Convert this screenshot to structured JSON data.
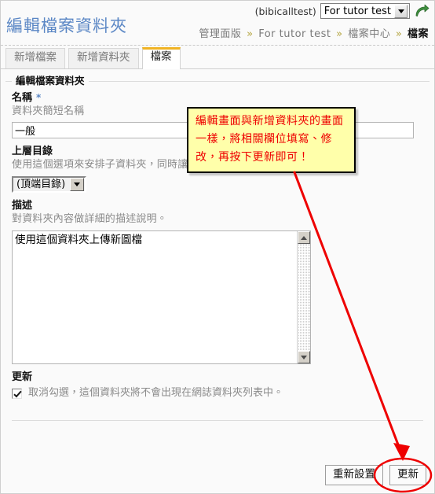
{
  "header": {
    "title": "編輯檔案資料夾",
    "user_label": "(bibicalltest)",
    "site_select_value": "For tutor test",
    "go_icon": "curved-arrow-icon",
    "breadcrumb": [
      {
        "label": "管理面版",
        "last": false
      },
      {
        "label": "For tutor test",
        "last": false
      },
      {
        "label": "檔案中心",
        "last": false
      },
      {
        "label": "檔案",
        "last": true
      }
    ],
    "breadcrumb_separator": "»"
  },
  "tabs": [
    {
      "label": "新增檔案",
      "active": false
    },
    {
      "label": "新增資料夾",
      "active": false
    },
    {
      "label": "檔案",
      "active": true
    }
  ],
  "form": {
    "legend": "編輯檔案資料夾",
    "name": {
      "label": "名稱",
      "required_marker": "*",
      "help": "資料夾簡短名稱",
      "value": "一般",
      "placeholder": ""
    },
    "parent": {
      "label": "上層目錄",
      "help": "使用這個選項來安排子資料夾，同時讓你的檔案放置更有組織。",
      "selected": "(頂端目錄)"
    },
    "description": {
      "label": "描述",
      "help": "對資料夾內容做詳細的描述說明。",
      "value": "使用這個資料夾上傳新圖檔"
    },
    "update": {
      "label": "更新",
      "checkbox_checked": true,
      "checkbox_text": "取消勾選，這個資料夾將不會出現在網誌資料夾列表中。"
    }
  },
  "footer": {
    "reset_label": "重新設置",
    "submit_label": "更新"
  },
  "annotations": {
    "callout_text": "編輯畫面與新增資料夾的畫面一樣，將相關欄位填寫、修改，再按下更新即可！",
    "callout_color": "#ee0000",
    "callout_background": "#ffffaa",
    "arrow_color": "#ee0000",
    "highlight_shape": "ellipse-around-update-button"
  }
}
